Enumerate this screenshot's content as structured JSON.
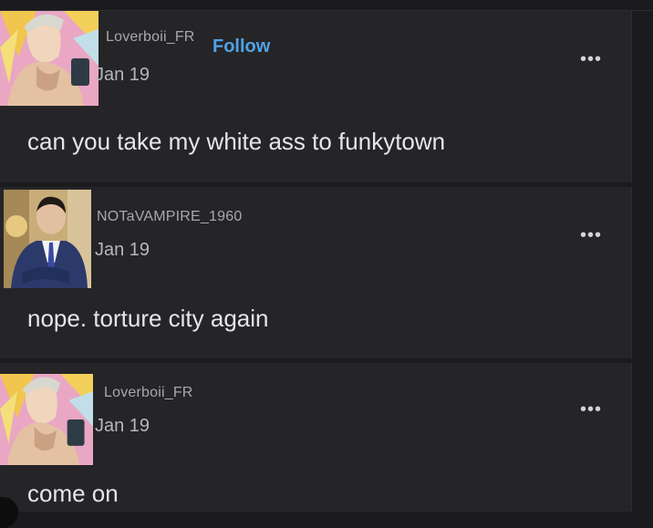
{
  "posts": [
    {
      "username": "Loverboii_FR",
      "follow_label": "Follow",
      "date": "Jan 19",
      "more_label": "•••",
      "text": "can you take my white ass to funkytown",
      "avatar_icon": "anime-character-avatar"
    },
    {
      "username": "NOTaVAMPIRE_1960",
      "date": "Jan 19",
      "more_label": "•••",
      "text": "nope. torture city again",
      "avatar_icon": "man-in-suit-avatar"
    },
    {
      "username": "Loverboii_FR",
      "date": "Jan 19",
      "more_label": "•••",
      "text": "come on",
      "avatar_icon": "anime-character-avatar"
    }
  ],
  "colors": {
    "background": "#1b1b1d",
    "card": "#252527",
    "follow": "#4fa3e6",
    "text": "#e6e6e8",
    "muted": "#a8a8ac"
  }
}
